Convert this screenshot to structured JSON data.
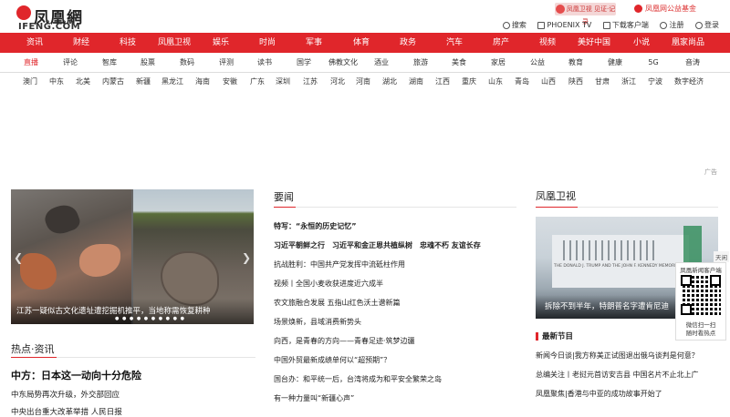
{
  "header": {
    "logo_cn": "凤凰網",
    "logo_en": "IFENG.COM",
    "promo_left": "凤凰卫视 见证·记录",
    "promo_right": "凤凰网公益基金",
    "links": [
      "搜索",
      "PHOENIX TV",
      "下载客户端",
      "注册",
      "登录"
    ]
  },
  "nav_main": [
    "资讯",
    "财经",
    "科技",
    "凤凰卫视",
    "娱乐",
    "时尚",
    "军事",
    "体育",
    "政务",
    "汽车",
    "房产",
    "视频",
    "美好中国",
    "小说",
    "凰家尚品"
  ],
  "nav_second": [
    "直播",
    "评论",
    "智库",
    "股票",
    "数码",
    "评测",
    "读书",
    "国学",
    "佛教文化",
    "酒业",
    "旅游",
    "美食",
    "家居",
    "公益",
    "教育",
    "健康",
    "5G",
    "音涛"
  ],
  "nav_region": [
    "澳门",
    "中东",
    "北美",
    "内蒙古",
    "新疆",
    "黑龙江",
    "海南",
    "安徽",
    "广东",
    "深圳",
    "江苏",
    "河北",
    "河南",
    "湖北",
    "湖南",
    "江西",
    "重庆",
    "山东",
    "青岛",
    "山西",
    "陕西",
    "甘肃",
    "浙江",
    "宁波",
    "数字经济"
  ],
  "ad_label": "广告",
  "slideshow": {
    "caption": "江苏一疑似古文化遗址遭挖掘机推平，当地称需恢复耕种",
    "dots": "● ● ● ● ● ● ● ● ● ●"
  },
  "hot": {
    "heading": "热点·资讯",
    "title": "中方：日本这一动向十分危险",
    "items": [
      "中东局势再次升级，外交部回应",
      "中央出台重大改革举措 人民日报"
    ]
  },
  "news": {
    "heading": "要闻",
    "items": [
      {
        "text": "特写：“永恒的历史记忆”",
        "bold": true
      },
      {
        "text": "习近平朝鲜之行　习近平和金正恩共植纵树　忠魂不朽 友谊长存",
        "bold": true
      },
      {
        "text": "抗战胜利：中国共产党发挥中流砥柱作用",
        "bold": false
      },
      {
        "text": "视频丨全国小麦收获进度近六成半",
        "bold": false
      },
      {
        "text": "农文旅融合发展 五指山红色沃土谱新篇",
        "bold": false
      },
      {
        "text": "场景焕新，县域消费新势头",
        "bold": false
      },
      {
        "text": "向西，是青春的方向——青春足迹·筑梦边疆",
        "bold": false
      },
      {
        "text": "中国外贸最新成绩单何以“超预期”？",
        "bold": false
      },
      {
        "text": "国台办：和平统一后，台湾将成为和平安全繁荣之岛",
        "bold": false
      },
      {
        "text": "有一种力量叫“新疆心声”",
        "bold": false
      }
    ]
  },
  "phoenix_tv": {
    "heading": "凤凰卫视",
    "caption": "拆除不到半年，特朗普名字遭肯尼迪",
    "sign": "THE DONALD J. TRUMP AND THE JOHN F. KENNEDY MEMORIAL CENTER FOR THE",
    "newest_heading": "最新节目",
    "items": [
      "新闻今日谈|我方称美正试图退出俄乌谈判是何意？",
      "总编关注丨老挝元首访安吉县 中国名片不止北上广",
      "凤凰聚焦|香港与中亚的成功故事开始了"
    ]
  },
  "qr": {
    "side_tab": "天闲",
    "top": "凤凰新闻客户端",
    "bottom1": "微信扫一扫",
    "bottom2": "随时看热点"
  }
}
